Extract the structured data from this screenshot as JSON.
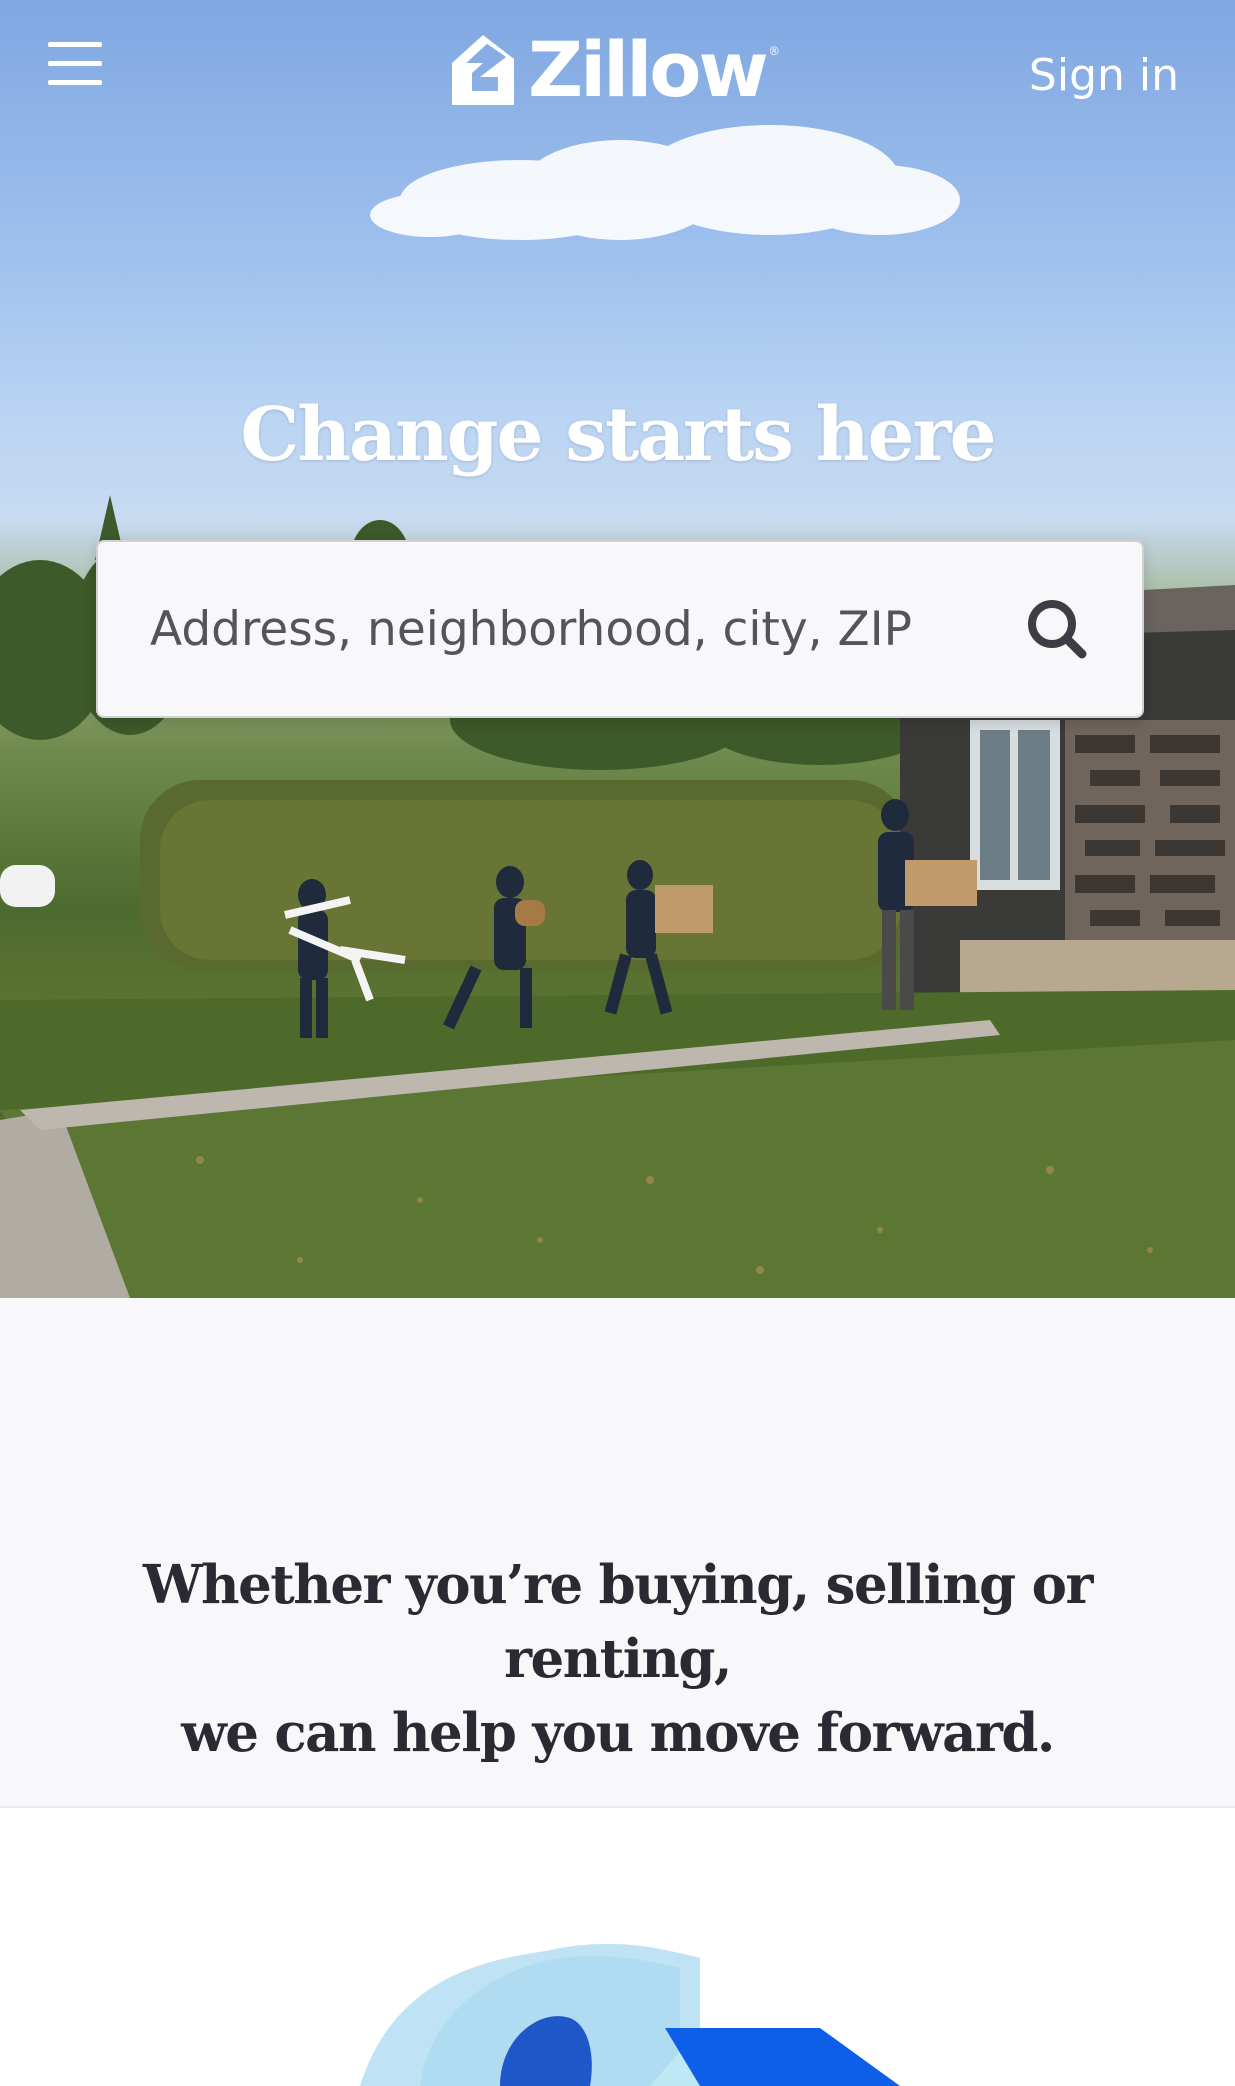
{
  "header": {
    "menu_icon": "hamburger-icon",
    "logo_text": "Zillow",
    "logo_reg": "®",
    "signin_label": "Sign in"
  },
  "hero": {
    "headline": "Change starts here",
    "search": {
      "placeholder": "Address, neighborhood, city, ZIP",
      "value": "",
      "icon": "search-icon"
    }
  },
  "tagline": {
    "line1": "Whether you’re buying, selling or renting,",
    "line2": "we can help you move forward."
  },
  "colors": {
    "brand_blue": "#006aff",
    "text_dark": "#2a2a33",
    "placeholder": "#54545a"
  }
}
